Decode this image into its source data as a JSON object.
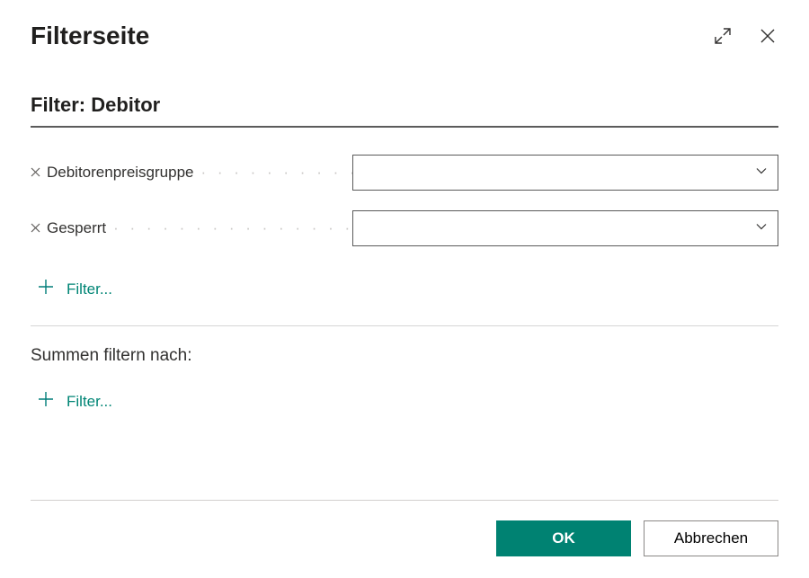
{
  "header": {
    "title": "Filterseite"
  },
  "section": {
    "heading": "Filter: Debitor",
    "filters": [
      {
        "label": "Debitorenpreisgruppe",
        "value": ""
      },
      {
        "label": "Gesperrt",
        "value": ""
      }
    ],
    "add_label": "Filter..."
  },
  "totals": {
    "heading": "Summen filtern nach:",
    "add_label": "Filter..."
  },
  "footer": {
    "ok": "OK",
    "cancel": "Abbrechen"
  }
}
